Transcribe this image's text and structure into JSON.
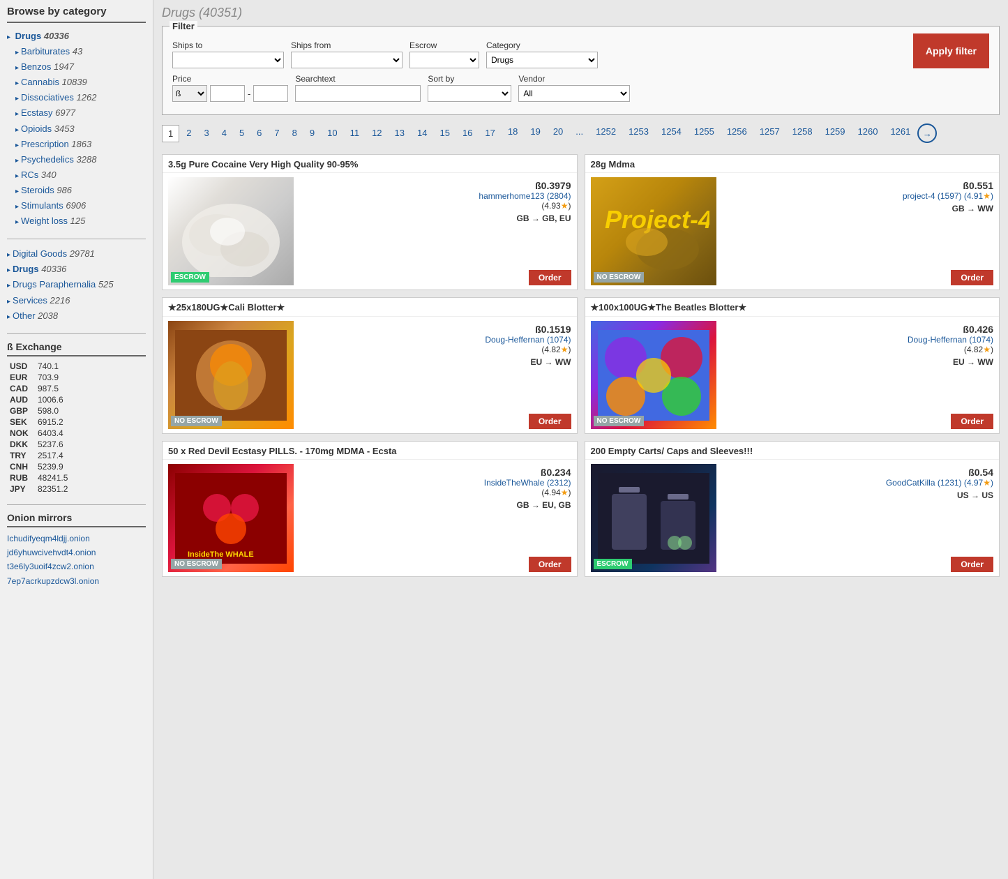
{
  "sidebar": {
    "title": "Browse by category",
    "drugs_section": {
      "heading": "Drugs",
      "heading_count": "40336",
      "items": [
        {
          "label": "Barbiturates",
          "count": "43"
        },
        {
          "label": "Benzos",
          "count": "1947"
        },
        {
          "label": "Cannabis",
          "count": "10839"
        },
        {
          "label": "Dissociatives",
          "count": "1262"
        },
        {
          "label": "Ecstasy",
          "count": "6977"
        },
        {
          "label": "Opioids",
          "count": "3453"
        },
        {
          "label": "Prescription",
          "count": "1863"
        },
        {
          "label": "Psychedelics",
          "count": "3288"
        },
        {
          "label": "RCs",
          "count": "340"
        },
        {
          "label": "Steroids",
          "count": "986"
        },
        {
          "label": "Stimulants",
          "count": "6906"
        },
        {
          "label": "Weight loss",
          "count": "125"
        }
      ]
    },
    "main_categories": [
      {
        "label": "Digital Goods",
        "count": "29781"
      },
      {
        "label": "Drugs",
        "count": "40336"
      },
      {
        "label": "Drugs Paraphernalia",
        "count": "525"
      },
      {
        "label": "Services",
        "count": "2216"
      },
      {
        "label": "Other",
        "count": "2038"
      }
    ],
    "exchange": {
      "title": "ß Exchange",
      "rates": [
        {
          "currency": "USD",
          "value": "740.1"
        },
        {
          "currency": "EUR",
          "value": "703.9"
        },
        {
          "currency": "CAD",
          "value": "987.5"
        },
        {
          "currency": "AUD",
          "value": "1006.6"
        },
        {
          "currency": "GBP",
          "value": "598.0"
        },
        {
          "currency": "SEK",
          "value": "6915.2"
        },
        {
          "currency": "NOK",
          "value": "6403.4"
        },
        {
          "currency": "DKK",
          "value": "5237.6"
        },
        {
          "currency": "TRY",
          "value": "2517.4"
        },
        {
          "currency": "CNH",
          "value": "5239.9"
        },
        {
          "currency": "RUB",
          "value": "48241.5"
        },
        {
          "currency": "JPY",
          "value": "82351.2"
        }
      ]
    },
    "mirrors": {
      "title": "Onion mirrors",
      "links": [
        "Ichudifyeqm4ldjj.onion",
        "jd6yhuwcivehvdt4.onion",
        "t3e6ly3uoif4zcw2.onion",
        "7ep7acrkupzdcw3l.onion"
      ]
    }
  },
  "main": {
    "page_title": "Drugs (40351)",
    "filter": {
      "legend": "Filter",
      "ships_to_label": "Ships to",
      "ships_from_label": "Ships from",
      "escrow_label": "Escrow",
      "category_label": "Category",
      "category_value": "Drugs",
      "price_label": "Price",
      "price_currency": "ß",
      "searchtext_label": "Searchtext",
      "sort_by_label": "Sort by",
      "vendor_label": "Vendor",
      "vendor_value": "All",
      "apply_button": "Apply filter"
    },
    "pagination": {
      "pages_row1": [
        "1",
        "2",
        "3",
        "4",
        "5",
        "6",
        "7",
        "8",
        "9",
        "10",
        "11",
        "12",
        "13",
        "14",
        "15",
        "16",
        "17"
      ],
      "pages_row2": [
        "18",
        "19",
        "20",
        "...",
        "1252",
        "1253",
        "1254",
        "1255",
        "1256",
        "1257",
        "1258",
        "1259",
        "1260",
        "1261"
      ],
      "current": "1",
      "next_arrow": "→"
    },
    "products": [
      {
        "title": "3.5g Pure Cocaine Very High Quality 90-95%",
        "price": "ß0.3979",
        "vendor": "hammerhome123 (2804)",
        "rating": "(4.93★)",
        "shipping": "GB → GB, EU",
        "escrow": "ESCROW",
        "escrow_type": "escrow",
        "img_class": "product-img-cocaine",
        "order_label": "Order"
      },
      {
        "title": "28g Mdma",
        "price": "ß0.551",
        "vendor": "project-4 (1597) (4.91★)",
        "rating": "",
        "shipping": "GB → WW",
        "escrow": "NO ESCROW",
        "escrow_type": "no-escrow",
        "img_class": "product-img-mdma",
        "order_label": "Order"
      },
      {
        "title": "★25x180UG★Cali Blotter★",
        "price": "ß0.1519",
        "vendor": "Doug-Heffernan (1074)",
        "rating": "(4.82★)",
        "shipping": "EU → WW",
        "escrow": "NO ESCROW",
        "escrow_type": "no-escrow",
        "img_class": "product-img-blotter1",
        "order_label": "Order"
      },
      {
        "title": "★100x100UG★The Beatles Blotter★",
        "price": "ß0.426",
        "vendor": "Doug-Heffernan (1074)",
        "rating": "(4.82★)",
        "shipping": "EU → WW",
        "escrow": "NO ESCROW",
        "escrow_type": "no-escrow",
        "img_class": "product-img-blotter2",
        "order_label": "Order"
      },
      {
        "title": "50 x Red Devil Ecstasy PILLS. - 170mg MDMA - Ecsta",
        "price": "ß0.234",
        "vendor": "InsideTheWhale (2312)",
        "rating": "(4.94★)",
        "shipping": "GB → EU, GB",
        "escrow": "NO ESCROW",
        "escrow_type": "no-escrow",
        "img_class": "product-img-ecstasy",
        "order_label": "Order"
      },
      {
        "title": "200 Empty Carts/ Caps and Sleeves!!!",
        "price": "ß0.54",
        "vendor": "GoodCatKilla (1231) (4.97★)",
        "rating": "",
        "shipping": "US → US",
        "escrow": "ESCROW",
        "escrow_type": "escrow",
        "img_class": "product-img-carts",
        "order_label": "Order"
      }
    ]
  }
}
